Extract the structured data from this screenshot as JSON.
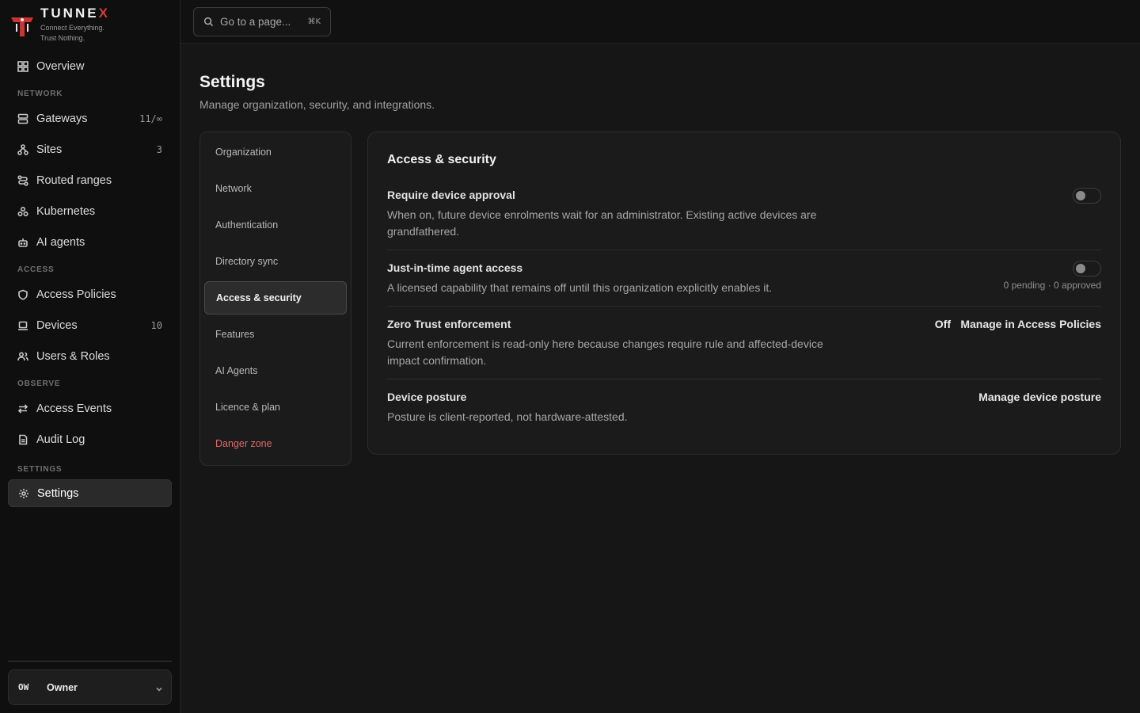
{
  "brand": {
    "name_main": "TUNNE",
    "name_accent": "X",
    "tagline_1": "Connect Everything.",
    "tagline_2": "Trust Nothing."
  },
  "sidebar": {
    "overview": {
      "label": "Overview",
      "icon": "grid-icon"
    },
    "sections": {
      "network": "NETWORK",
      "access": "ACCESS",
      "observe": "OBSERVE",
      "settings": "SETTINGS"
    },
    "gateways": {
      "label": "Gateways",
      "count": "11/∞",
      "icon": "server-icon"
    },
    "sites": {
      "label": "Sites",
      "count": "3",
      "icon": "sitemap-icon"
    },
    "routed_ranges": {
      "label": "Routed ranges",
      "icon": "route-icon"
    },
    "kubernetes": {
      "label": "Kubernetes",
      "icon": "cluster-icon"
    },
    "ai_agents": {
      "label": "AI agents",
      "icon": "bot-icon"
    },
    "access_policies": {
      "label": "Access Policies",
      "icon": "shield-icon"
    },
    "devices": {
      "label": "Devices",
      "count": "10",
      "icon": "laptop-icon"
    },
    "users_roles": {
      "label": "Users & Roles",
      "icon": "users-icon"
    },
    "access_events": {
      "label": "Access Events",
      "icon": "arrows-icon"
    },
    "audit_log": {
      "label": "Audit Log",
      "icon": "document-icon"
    },
    "settings": {
      "label": "Settings",
      "icon": "gear-icon"
    }
  },
  "user": {
    "initials": "OW",
    "role": "Owner"
  },
  "search": {
    "placeholder": "Go to a page...",
    "shortcut": "⌘K"
  },
  "page": {
    "title": "Settings",
    "subtitle": "Manage organization, security, and integrations."
  },
  "subnav": {
    "organization": "Organization",
    "network": "Network",
    "authentication": "Authentication",
    "directory_sync": "Directory sync",
    "access_security": "Access & security",
    "features": "Features",
    "ai_agents": "AI Agents",
    "licence_plan": "Licence & plan",
    "danger_zone": "Danger zone"
  },
  "panel": {
    "title": "Access & security",
    "device_approval": {
      "title": "Require device approval",
      "description": "When on, future device enrolments wait for an administrator. Existing active devices are grandfathered.",
      "enabled": false
    },
    "jit_access": {
      "title": "Just-in-time agent access",
      "description": "A licensed capability that remains off until this organization explicitly enables it.",
      "meta": "0 pending · 0 approved",
      "enabled": false
    },
    "zero_trust": {
      "title": "Zero Trust enforcement",
      "description": "Current enforcement is read-only here because changes require rule and affected-device impact confirmation.",
      "status": "Off",
      "link": "Manage in Access Policies"
    },
    "device_posture": {
      "title": "Device posture",
      "description": "Posture is client-reported, not hardware-attested.",
      "link": "Manage device posture"
    }
  },
  "colors": {
    "accent": "#d23b3b",
    "danger": "#e06a6a",
    "background": "#161616"
  }
}
